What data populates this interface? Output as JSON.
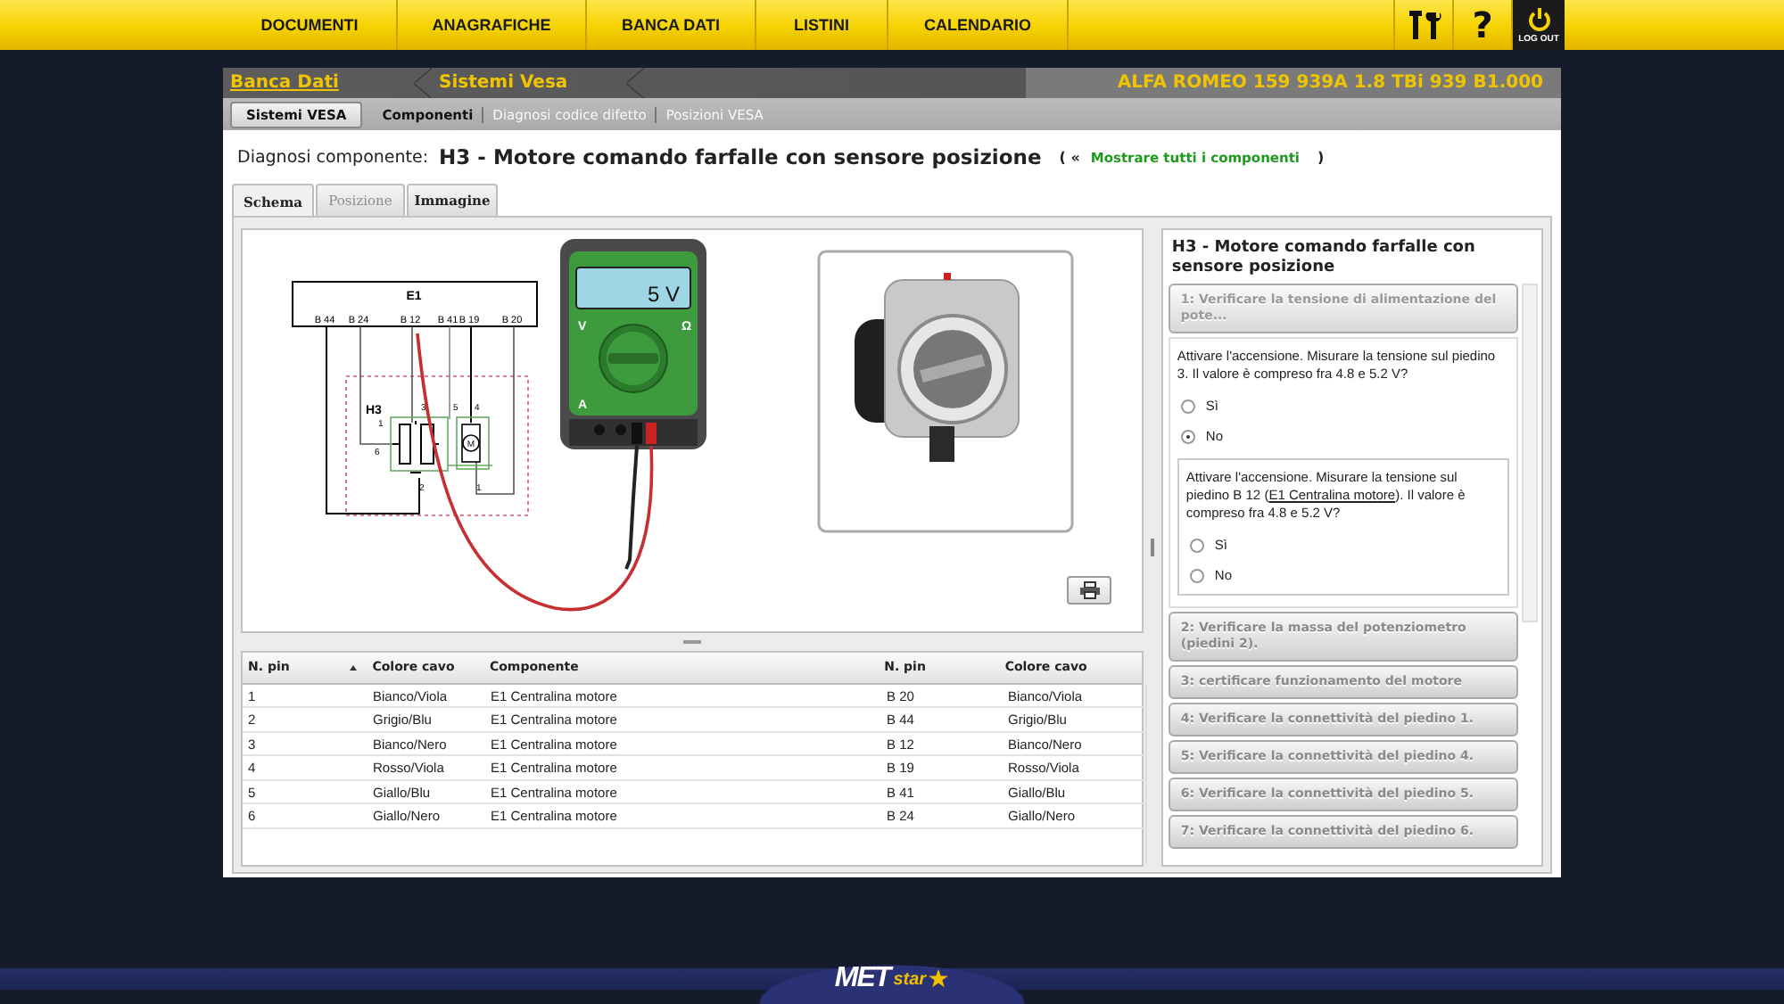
{
  "top_nav": {
    "items": [
      {
        "label": "DOCUMENTI"
      },
      {
        "label": "ANAGRAFICHE"
      },
      {
        "label": "BANCA DATI"
      },
      {
        "label": "LISTINI"
      },
      {
        "label": "CALENDARIO"
      }
    ],
    "help_label": "?",
    "logout_label": "LOG OUT"
  },
  "breadcrumb": [
    {
      "label": "Banca Dati",
      "link": true
    },
    {
      "label": "Sistemi Vesa",
      "link": false
    }
  ],
  "vehicle": "ALFA ROMEO 159 939A 1.8 TBi 939 B1.000",
  "subnav": [
    {
      "label": "Sistemi VESA",
      "kind": "button",
      "selected": false
    },
    {
      "label": "Componenti",
      "kind": "link",
      "selected": true
    },
    {
      "label": "Diagnosi codice difetto",
      "kind": "link",
      "selected": false
    },
    {
      "label": "Posizioni VESA",
      "kind": "link",
      "selected": false
    }
  ],
  "heading": {
    "label": "Diagnosi componente:",
    "title": "H3 - Motore comando farfalle con sensore posizione",
    "open": "( «",
    "link": "Mostrare tutti i componenti",
    "close": ")"
  },
  "tabs": [
    {
      "label": "Schema",
      "selected": true,
      "disabled": false
    },
    {
      "label": "Posizione",
      "selected": false,
      "disabled": true
    },
    {
      "label": "Immagine",
      "selected": false,
      "disabled": false
    }
  ],
  "schematic": {
    "ecu": "E1",
    "pins": [
      "B 44",
      "B 24",
      "B 12",
      "B 41",
      "B 19",
      "B 20"
    ],
    "component": "H3",
    "connector_pins": [
      "1",
      "3",
      "5",
      "4",
      "6",
      "2",
      "1"
    ],
    "motor": "M"
  },
  "multimeter": {
    "reading": "5 V",
    "dial_labels": [
      "V",
      "Ω",
      "A"
    ]
  },
  "table": {
    "columns": [
      {
        "label": "N. pin",
        "sorted": true
      },
      {
        "label": "Colore cavo",
        "sorted": false
      },
      {
        "label": "Componente",
        "sorted": false
      },
      {
        "label": "N. pin",
        "sorted": false
      },
      {
        "label": "Colore cavo",
        "sorted": false
      }
    ],
    "rows": [
      [
        "1",
        "Bianco/Viola",
        "E1 Centralina motore",
        "B 20",
        "Bianco/Viola"
      ],
      [
        "2",
        "Grigio/Blu",
        "E1 Centralina motore",
        "B 44",
        "Grigio/Blu"
      ],
      [
        "3",
        "Bianco/Nero",
        "E1 Centralina motore",
        "B 12",
        "Bianco/Nero"
      ],
      [
        "4",
        "Rosso/Viola",
        "E1 Centralina motore",
        "B 19",
        "Rosso/Viola"
      ],
      [
        "5",
        "Giallo/Blu",
        "E1 Centralina motore",
        "B 41",
        "Giallo/Blu"
      ],
      [
        "6",
        "Giallo/Nero",
        "E1 Centralina motore",
        "B 24",
        "Giallo/Nero"
      ]
    ]
  },
  "steps_panel": {
    "title": "H3 - Motore comando farfalle con sensore posizione",
    "steps": [
      {
        "title": "1: Verificare la tensione di alimentazione del pote...",
        "expanded": true,
        "question": "Attivare l'accensione. Misurare la tensione sul piedino 3. Il valore è compreso fra 4.8 e 5.2 V?",
        "options": [
          {
            "label": "Sì",
            "selected": false
          },
          {
            "label": "No",
            "selected": true
          }
        ],
        "followup": {
          "question_before": "Attivare l'accensione. Misurare la tensione sul piedino B 12 (",
          "link": "E1 Centralina motore",
          "question_after": "). Il valore è compreso fra 4.8 e 5.2 V?",
          "options": [
            {
              "label": "Sì",
              "selected": false
            },
            {
              "label": "No",
              "selected": false
            }
          ]
        }
      },
      {
        "title": "2: Verificare la massa del potenziometro (piedini 2).",
        "expanded": false
      },
      {
        "title": "3: certificare funzionamento del motore",
        "expanded": false
      },
      {
        "title": "4: Verificare la connettività del piedino 1.",
        "expanded": false
      },
      {
        "title": "5: Verificare la connettività del piedino 4.",
        "expanded": false
      },
      {
        "title": "6: Verificare la connettività del piedino 5.",
        "expanded": false
      },
      {
        "title": "7: Verificare la connettività del piedino 6.",
        "expanded": false
      }
    ]
  },
  "footer": {
    "logo": "MET",
    "logo_badge": "star"
  }
}
